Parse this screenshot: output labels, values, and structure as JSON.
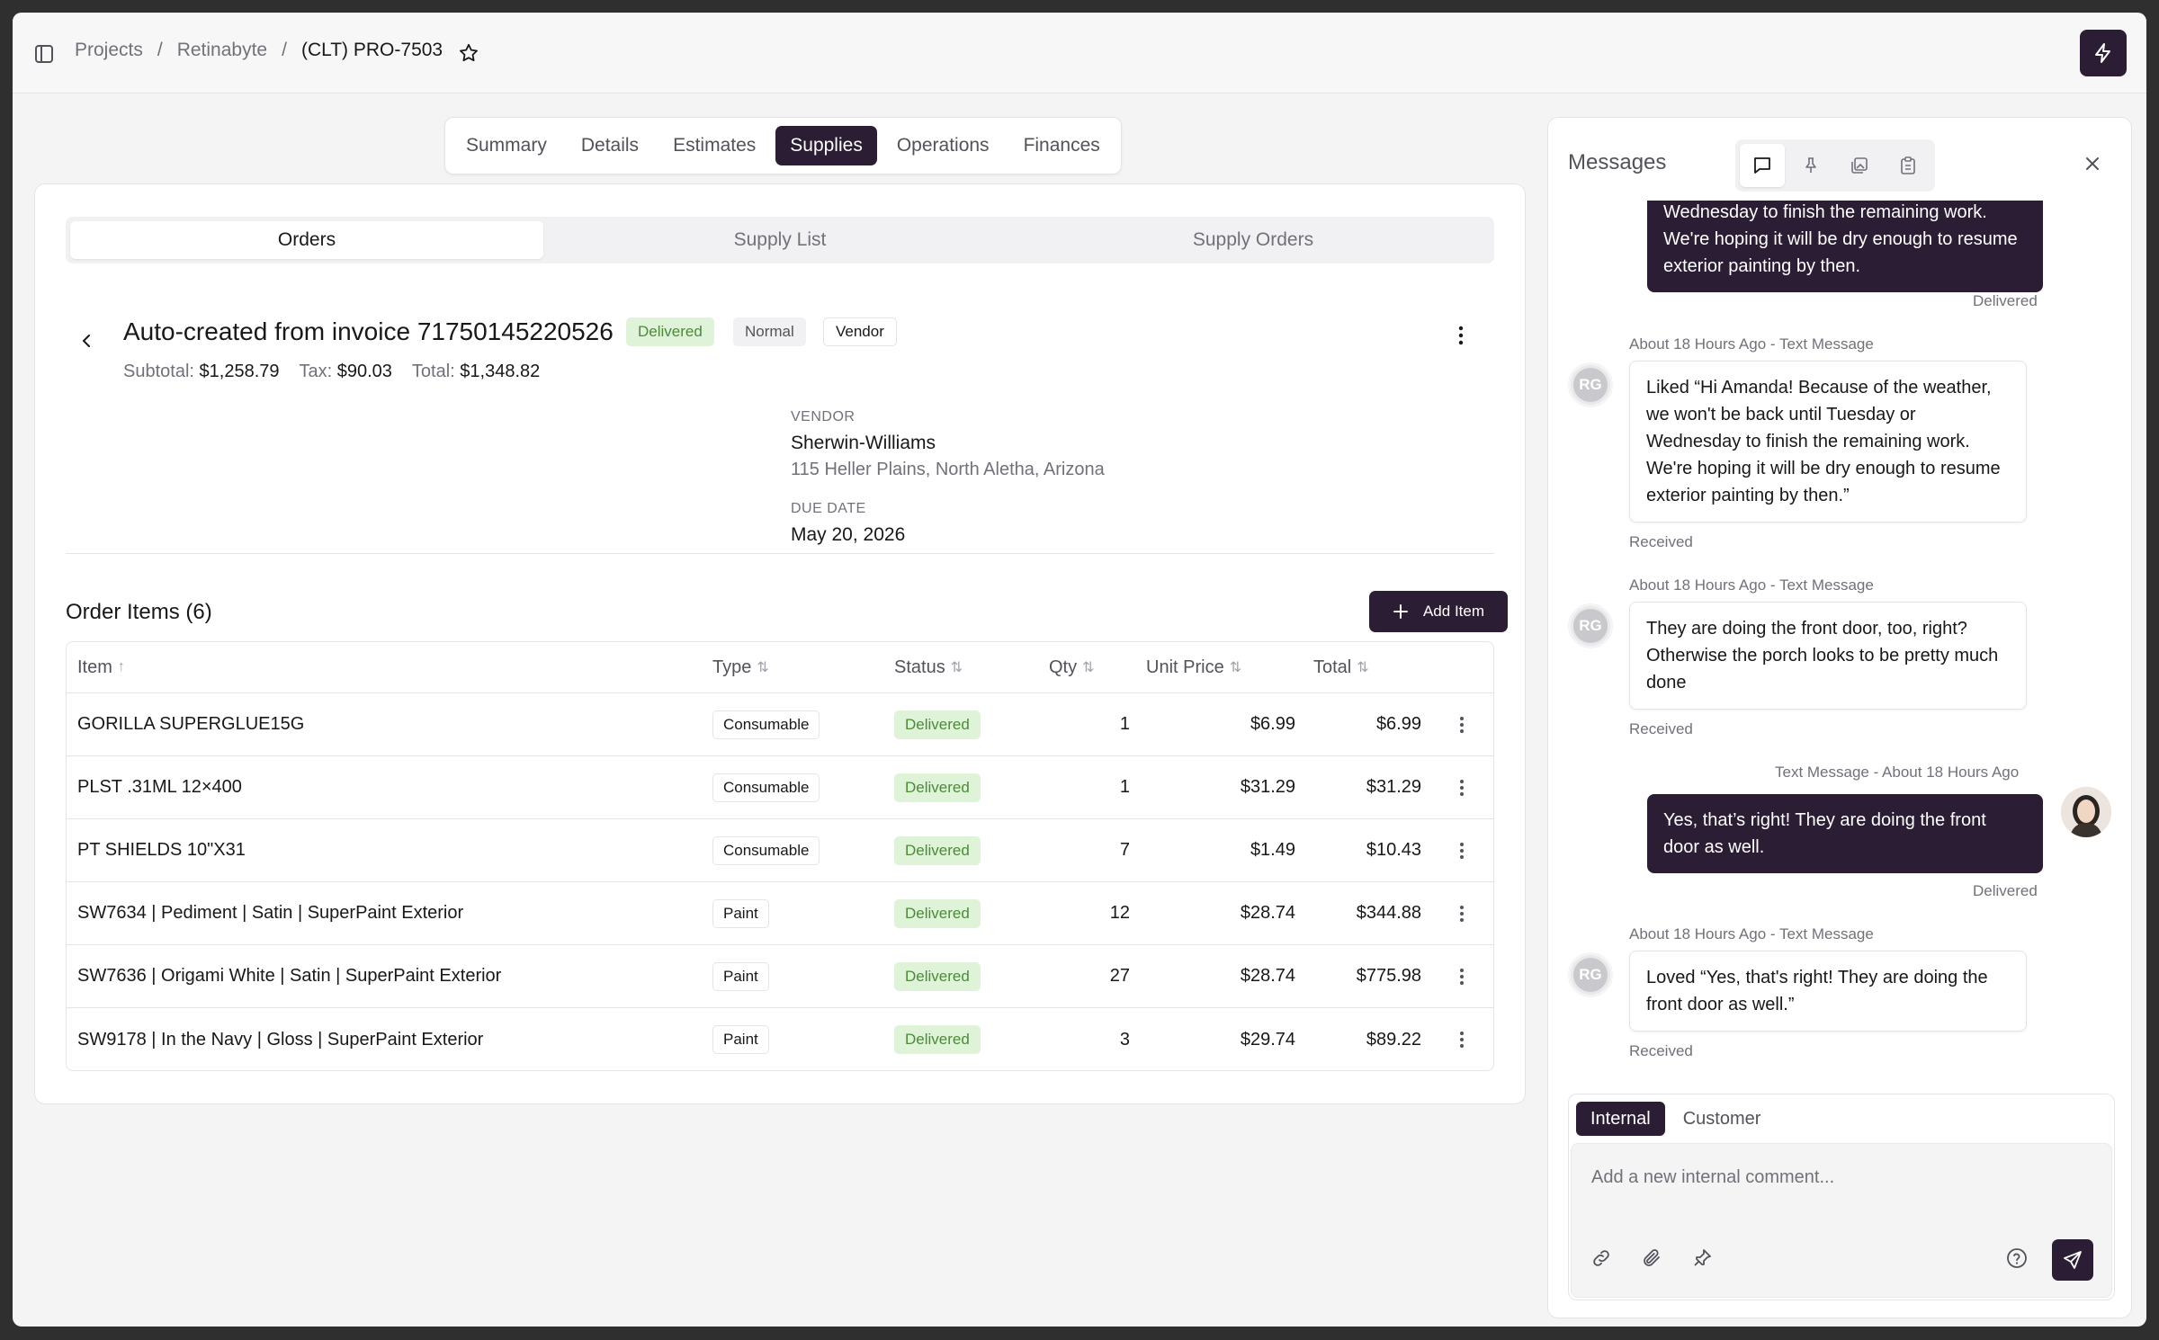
{
  "breadcrumb": {
    "projects": "Projects",
    "company": "Retinabyte",
    "current": "(CLT) PRO-7503"
  },
  "tabs": [
    "Summary",
    "Details",
    "Estimates",
    "Supplies",
    "Operations",
    "Finances"
  ],
  "active_tab": "Supplies",
  "segments": [
    "Orders",
    "Supply List",
    "Supply Orders"
  ],
  "order": {
    "title": "Auto-created from invoice 71750145220526",
    "badges": {
      "status": "Delivered",
      "priority": "Normal",
      "kind": "Vendor"
    },
    "subtotal_label": "Subtotal:",
    "subtotal": "$1,258.79",
    "tax_label": "Tax:",
    "tax": "$90.03",
    "total_label": "Total:",
    "total": "$1,348.82",
    "vendor_label": "VENDOR",
    "vendor_name": "Sherwin-Williams",
    "vendor_address": "115 Heller Plains, North Aletha, Arizona",
    "due_label": "DUE DATE",
    "due_date": "May 20, 2026"
  },
  "items": {
    "heading": "Order Items (6)",
    "add_label": "Add Item",
    "columns": {
      "item": "Item",
      "type": "Type",
      "status": "Status",
      "qty": "Qty",
      "unit": "Unit Price",
      "total": "Total"
    },
    "rows": [
      {
        "item": "GORILLA SUPERGLUE15G",
        "type": "Consumable",
        "status": "Delivered",
        "qty": "1",
        "unit": "$6.99",
        "total": "$6.99"
      },
      {
        "item": "PLST .31ML 12×400",
        "type": "Consumable",
        "status": "Delivered",
        "qty": "1",
        "unit": "$31.29",
        "total": "$31.29"
      },
      {
        "item": "PT SHIELDS 10\"X31",
        "type": "Consumable",
        "status": "Delivered",
        "qty": "7",
        "unit": "$1.49",
        "total": "$10.43"
      },
      {
        "item": "SW7634 | Pediment | Satin | SuperPaint Exterior",
        "type": "Paint",
        "status": "Delivered",
        "qty": "12",
        "unit": "$28.74",
        "total": "$344.88"
      },
      {
        "item": "SW7636 | Origami White | Satin | SuperPaint Exterior",
        "type": "Paint",
        "status": "Delivered",
        "qty": "27",
        "unit": "$28.74",
        "total": "$775.98"
      },
      {
        "item": "SW9178 | In the Navy | Gloss | SuperPaint Exterior",
        "type": "Paint",
        "status": "Delivered",
        "qty": "3",
        "unit": "$29.74",
        "total": "$89.22"
      }
    ]
  },
  "messages": {
    "title": "Messages",
    "m0": {
      "text": "Wednesday to finish the remaining work. We're hoping it will be dry enough to resume exterior painting by then.",
      "status": "Delivered"
    },
    "m1": {
      "meta": "About 18 Hours Ago - Text Message",
      "initials": "RG",
      "text": "Liked “Hi Amanda! Because of the weather, we won't be back until Tuesday or Wednesday to finish the remaining work. We're hoping it will be dry enough to resume exterior painting by then.”",
      "status": "Received"
    },
    "m2": {
      "meta": "About 18 Hours Ago - Text Message",
      "initials": "RG",
      "text": "They are doing the front door, too, right? Otherwise the porch looks to be pretty much done",
      "status": "Received"
    },
    "m3": {
      "meta": "Text Message - About 18 Hours Ago",
      "text": "Yes, that’s right! They are doing the front door as well.",
      "status": "Delivered"
    },
    "m4": {
      "meta": "About 18 Hours Ago - Text Message",
      "initials": "RG",
      "text": "Loved “Yes, that's right! They are doing the front door as well.”",
      "status": "Received"
    }
  },
  "composer": {
    "tab_internal": "Internal",
    "tab_customer": "Customer",
    "placeholder": "Add a new internal comment..."
  },
  "colors": {
    "accent": "#2b1d33",
    "success_bg": "#dff3d8",
    "success_text": "#4c8a3a"
  }
}
